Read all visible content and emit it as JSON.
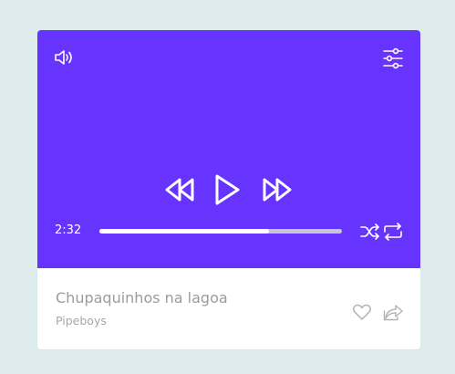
{
  "colors": {
    "background": "#deeced",
    "player_accent": "#6634fe",
    "progress_fill": "#ffffff",
    "progress_track": "#c9c6d4",
    "title_text": "#9c9c9c",
    "artist_text": "#a8a8a8",
    "icon_muted": "#b3b3b3"
  },
  "player": {
    "current_time": "2:32",
    "progress_fraction": 0.7,
    "icons": {
      "volume": "volume-icon",
      "settings": "sliders-icon",
      "rewind": "rewind-icon",
      "play": "play-icon",
      "forward": "fast-forward-icon",
      "shuffle": "shuffle-icon",
      "repeat": "repeat-icon"
    }
  },
  "track": {
    "title": "Chupaquinhos na lagoa",
    "artist": "Pipeboys",
    "icons": {
      "like": "heart-icon",
      "share": "share-icon"
    }
  }
}
